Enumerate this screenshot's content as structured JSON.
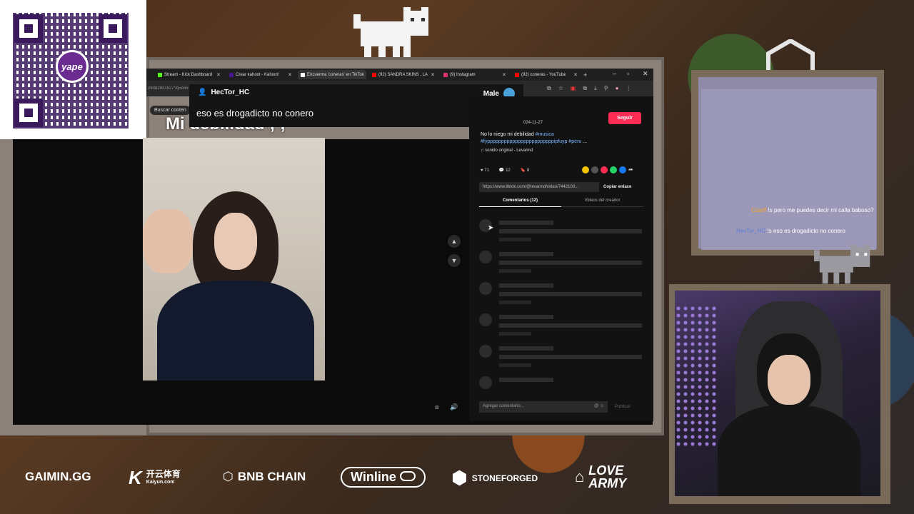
{
  "qr": {
    "brand": "yape"
  },
  "browser": {
    "tabs": [
      {
        "label": "Stream - Kick Dashboard",
        "color": "#53fc18"
      },
      {
        "label": "Crear kahoot - Kahoot!",
        "color": "#46178f"
      },
      {
        "label": "Encuentra 'coneras' en TikTok",
        "color": "#ffffff",
        "active": true
      },
      {
        "label": "(92) SANDRA SKINS , LA",
        "color": "#ff0000"
      },
      {
        "label": "(9) Instagram",
        "color": "#e1306c"
      },
      {
        "label": "(92) coneras - YouTube",
        "color": "#ff0000"
      }
    ],
    "url_fragment": "2938292152​7?q=con",
    "search_chip": "Buscar conten"
  },
  "overlay": {
    "username": "HecTor_HC",
    "right_label": "Male",
    "message": "eso es drogadicto no conero"
  },
  "video": {
    "caption": "Mi debilidad ; ;"
  },
  "tiktok": {
    "follow_label": "Seguir",
    "date": "024-11-27",
    "description_text": "No lo niego mi debilidad ",
    "description_tag1": "#musica",
    "description_tag2": "#fyppppppppppppppppppppppppipfuyp #peru",
    "description_more": "...",
    "sound": "sonido original - Levannd",
    "likes": "71",
    "comments": "12",
    "saves": "8",
    "link": "https://www.tiktok.com/@levannd/video/7442100...",
    "copy_label": "Copiar enlace",
    "tab_comments": "Comentarios (12)",
    "tab_creator": "Videos del creador",
    "comment_placeholder": "Agregar comentario...",
    "publish_label": "Publicar"
  },
  "chat": {
    "messages": [
      {
        "user": "Czarff",
        "text": "!s pero me puedes decir mi calla baboso?"
      },
      {
        "user": "HecTor_HC",
        "text": "!s eso es drogadicto no conero"
      }
    ]
  },
  "logo": {
    "text": "GG"
  },
  "sponsors": {
    "gaimin": "GAIMIN.GG",
    "kaiyun": "开云体育",
    "kaiyun_sub": "Kaiyun.com",
    "bnb": "BNB CHAIN",
    "winline": "Winline",
    "stoneforged": "STONEFORGED",
    "loveArmy1": "LOVE",
    "loveArmy2": "ARMY"
  }
}
